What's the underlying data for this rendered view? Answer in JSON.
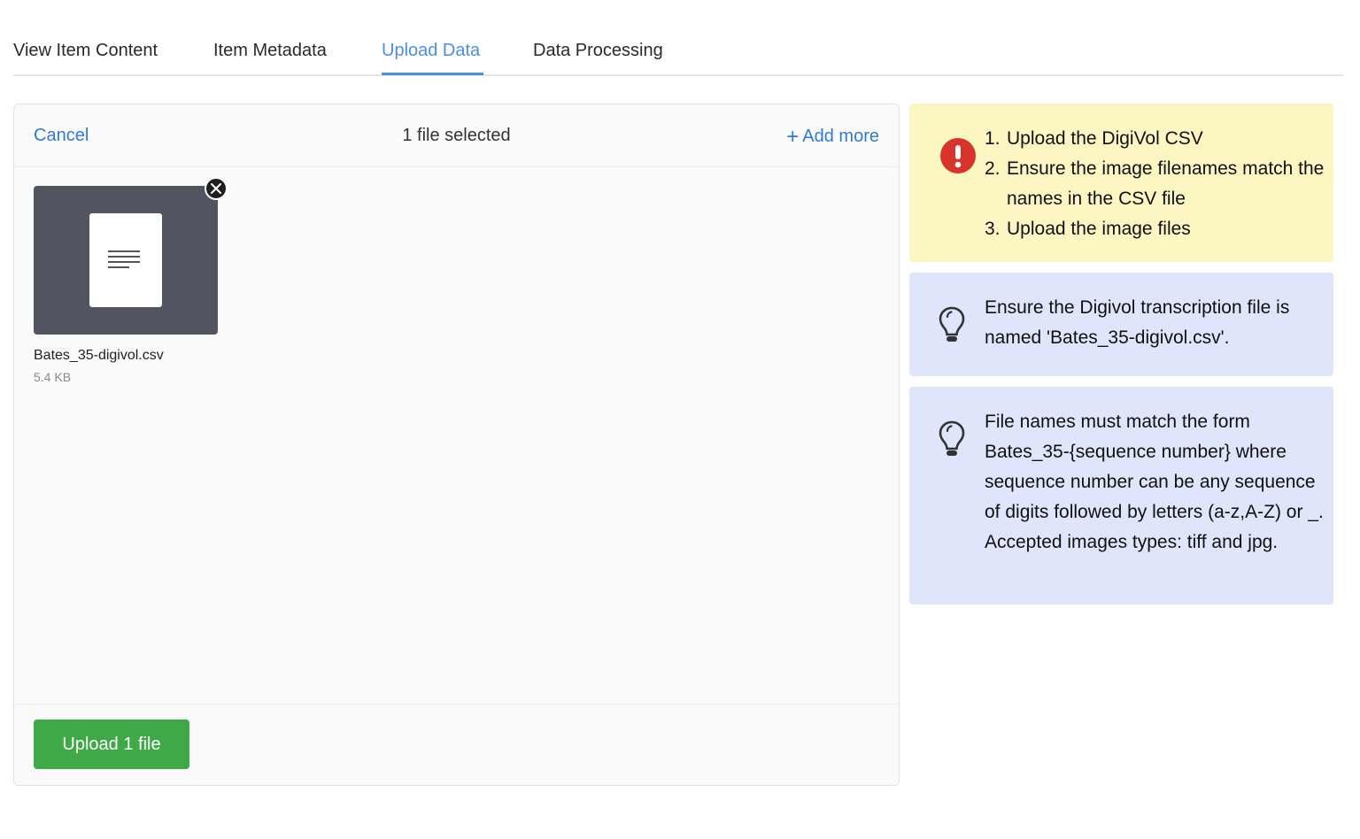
{
  "tabs": [
    {
      "label": "View Item Content",
      "active": false
    },
    {
      "label": "Item Metadata",
      "active": false
    },
    {
      "label": "Upload Data",
      "active": true
    },
    {
      "label": "Data Processing",
      "active": false
    }
  ],
  "uploader": {
    "cancel_label": "Cancel",
    "status": "1 file selected",
    "add_more_label": "Add more",
    "files": [
      {
        "name": "Bates_35-digivol.csv",
        "size": "5.4 KB",
        "icon": "document-icon"
      }
    ],
    "upload_button": "Upload 1 file"
  },
  "notes": {
    "warning": {
      "icon": "exclamation-icon",
      "steps": [
        {
          "num": "1.",
          "text": "Upload the DigiVol CSV"
        },
        {
          "num": "2.",
          "text": "Ensure the image filenames match the names in the CSV file"
        },
        {
          "num": "3.",
          "text": "Upload the image files"
        }
      ]
    },
    "tip1": {
      "icon": "lightbulb-icon",
      "text": "Ensure the Digivol transcription file is named 'Bates_35-digivol.csv'."
    },
    "tip2": {
      "icon": "lightbulb-icon",
      "text": "File names must match the form Bates_35-{sequence number} where sequence number can be any sequence of digits followed by letters (a-z,A-Z) or _.",
      "accepted": "Accepted images types: tiff and jpg."
    }
  },
  "colors": {
    "accent": "#4a90e2",
    "link": "#2f7bd6",
    "upload_button": "#3fa947",
    "warning_bg": "#fcf6c2",
    "warning_icon": "#d9342b",
    "tip_bg": "#dfe5fa"
  }
}
